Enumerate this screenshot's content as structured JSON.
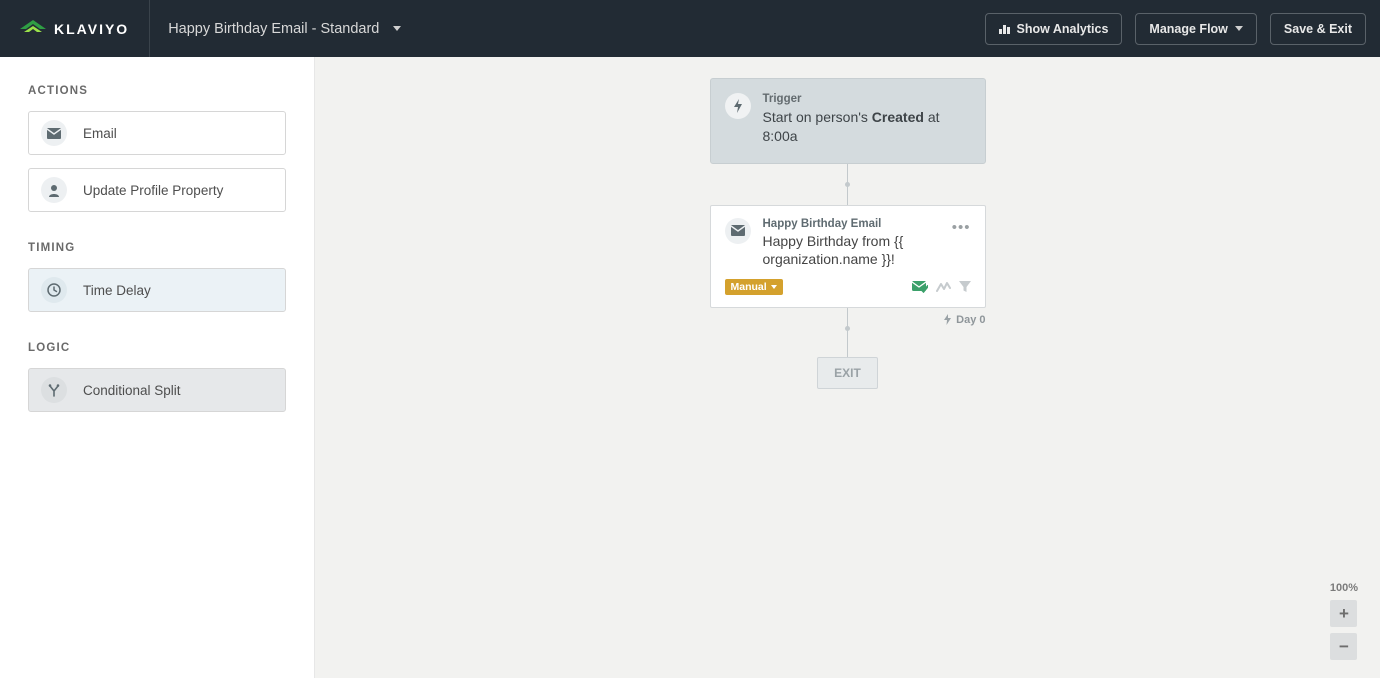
{
  "header": {
    "brand": "KLAVIYO",
    "flow_name": "Happy Birthday Email - Standard",
    "show_analytics": "Show Analytics",
    "manage_flow": "Manage Flow",
    "save_exit": "Save & Exit"
  },
  "sidebar": {
    "actions_title": "ACTIONS",
    "actions": [
      {
        "label": "Email",
        "icon": "mail"
      },
      {
        "label": "Update Profile Property",
        "icon": "person"
      }
    ],
    "timing_title": "TIMING",
    "timing": [
      {
        "label": "Time Delay",
        "icon": "clock"
      }
    ],
    "logic_title": "LOGIC",
    "logic": [
      {
        "label": "Conditional Split",
        "icon": "split"
      }
    ]
  },
  "flow": {
    "trigger": {
      "label": "Trigger",
      "prefix": "Start on person's ",
      "strong": "Created",
      "suffix": " at 8:00a"
    },
    "email_card": {
      "title": "Happy Birthday Email",
      "subject": "Happy Birthday from {{ organization.name }}!",
      "badge": "Manual",
      "day_label": "Day 0"
    },
    "exit_label": "EXIT"
  },
  "zoom": {
    "level": "100%",
    "plus": "+",
    "minus": "−"
  }
}
